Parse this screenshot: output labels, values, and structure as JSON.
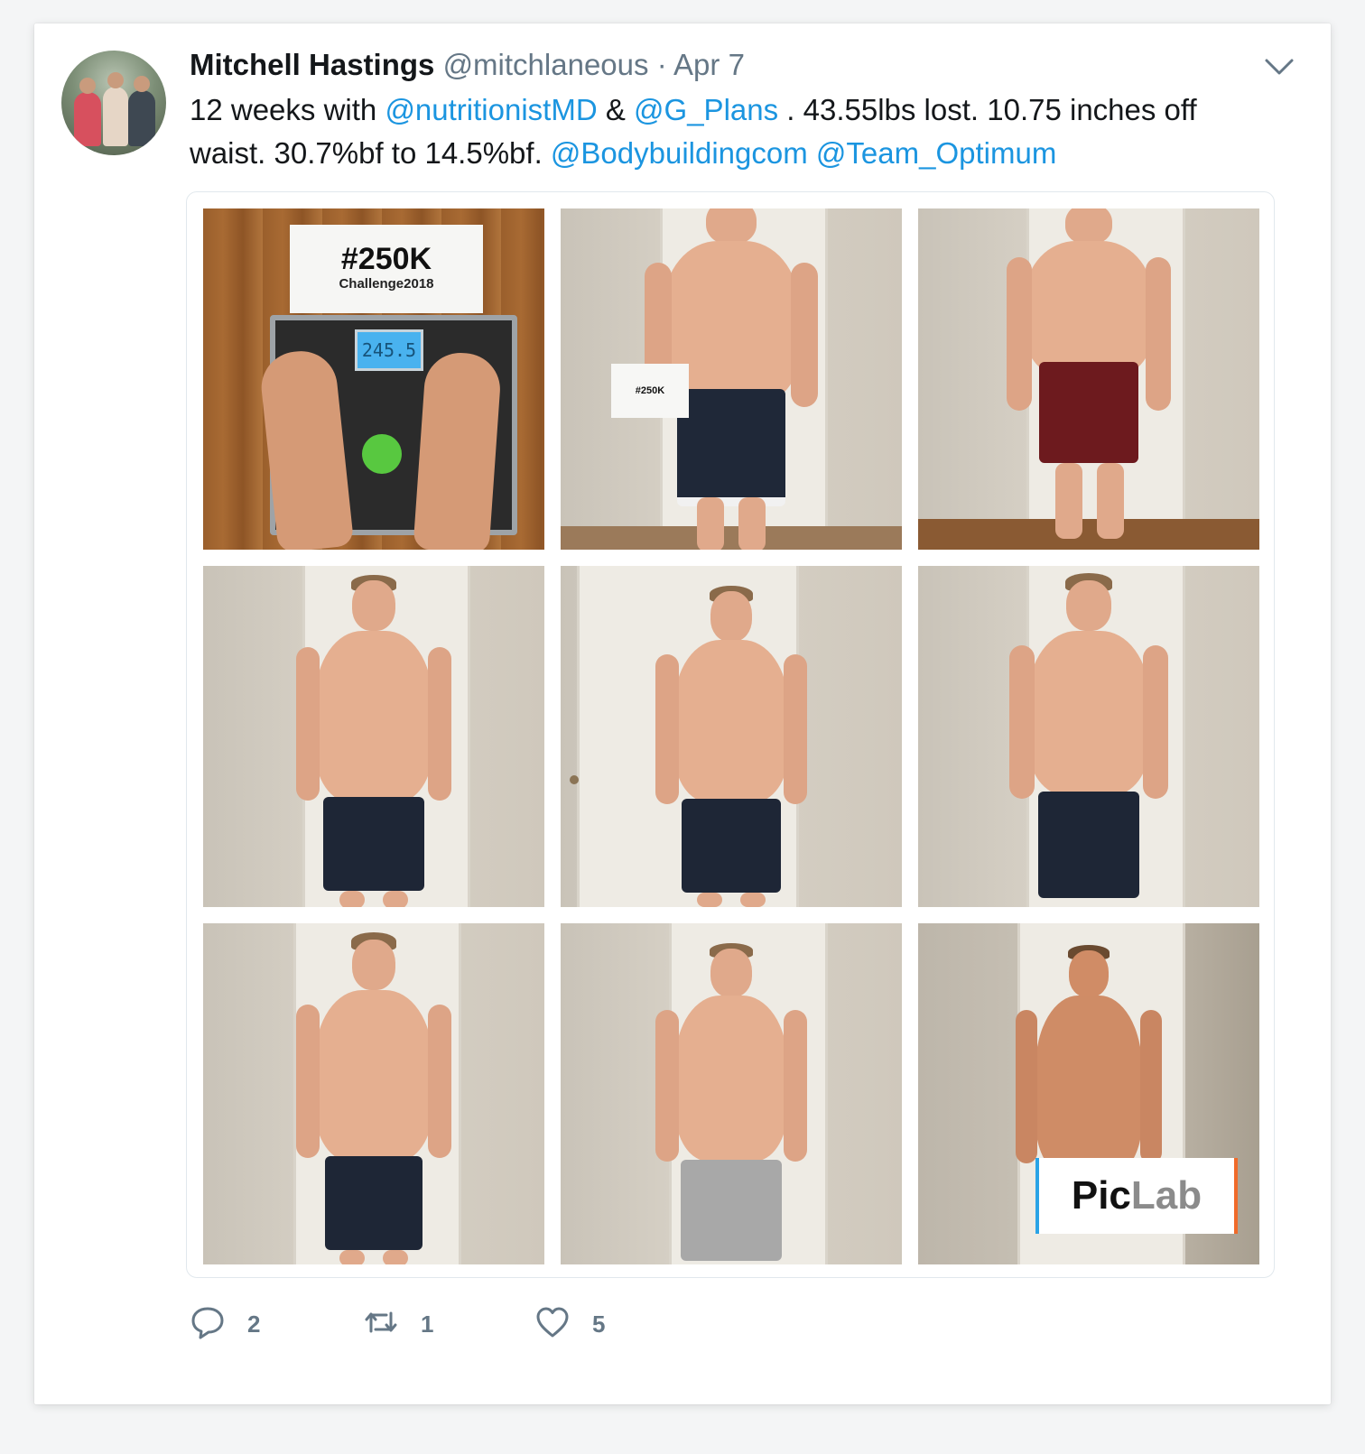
{
  "tweet": {
    "name": "Mitchell Hastings",
    "handle": "@mitchlaneous",
    "separator": "·",
    "date": "Apr 7",
    "text_parts": {
      "t1": "12 weeks with ",
      "m1": "@nutritionistMD",
      "t2": " & ",
      "m2": "@G_Plans",
      "t3": " . 43.55lbs lost. 10.75 inches off waist. 30.7%bf to 14.5%bf. ",
      "m3": "@Bodybuildingcom",
      "t4": " ",
      "m4": "@Team_Optimum"
    }
  },
  "media": {
    "sign_title": "#250K",
    "sign_subtitle": "Challenge2018",
    "scale_reading": "245.5",
    "held_sign": "#250K",
    "watermark_pic": "Pic",
    "watermark_lab": "Lab"
  },
  "actions": {
    "reply_count": "2",
    "retweet_count": "1",
    "like_count": "5"
  },
  "colors": {
    "link": "#1b95e0",
    "muted": "#657786",
    "text": "#14171a"
  },
  "icons": [
    "chevron-down-icon",
    "reply-icon",
    "retweet-icon",
    "like-icon"
  ]
}
